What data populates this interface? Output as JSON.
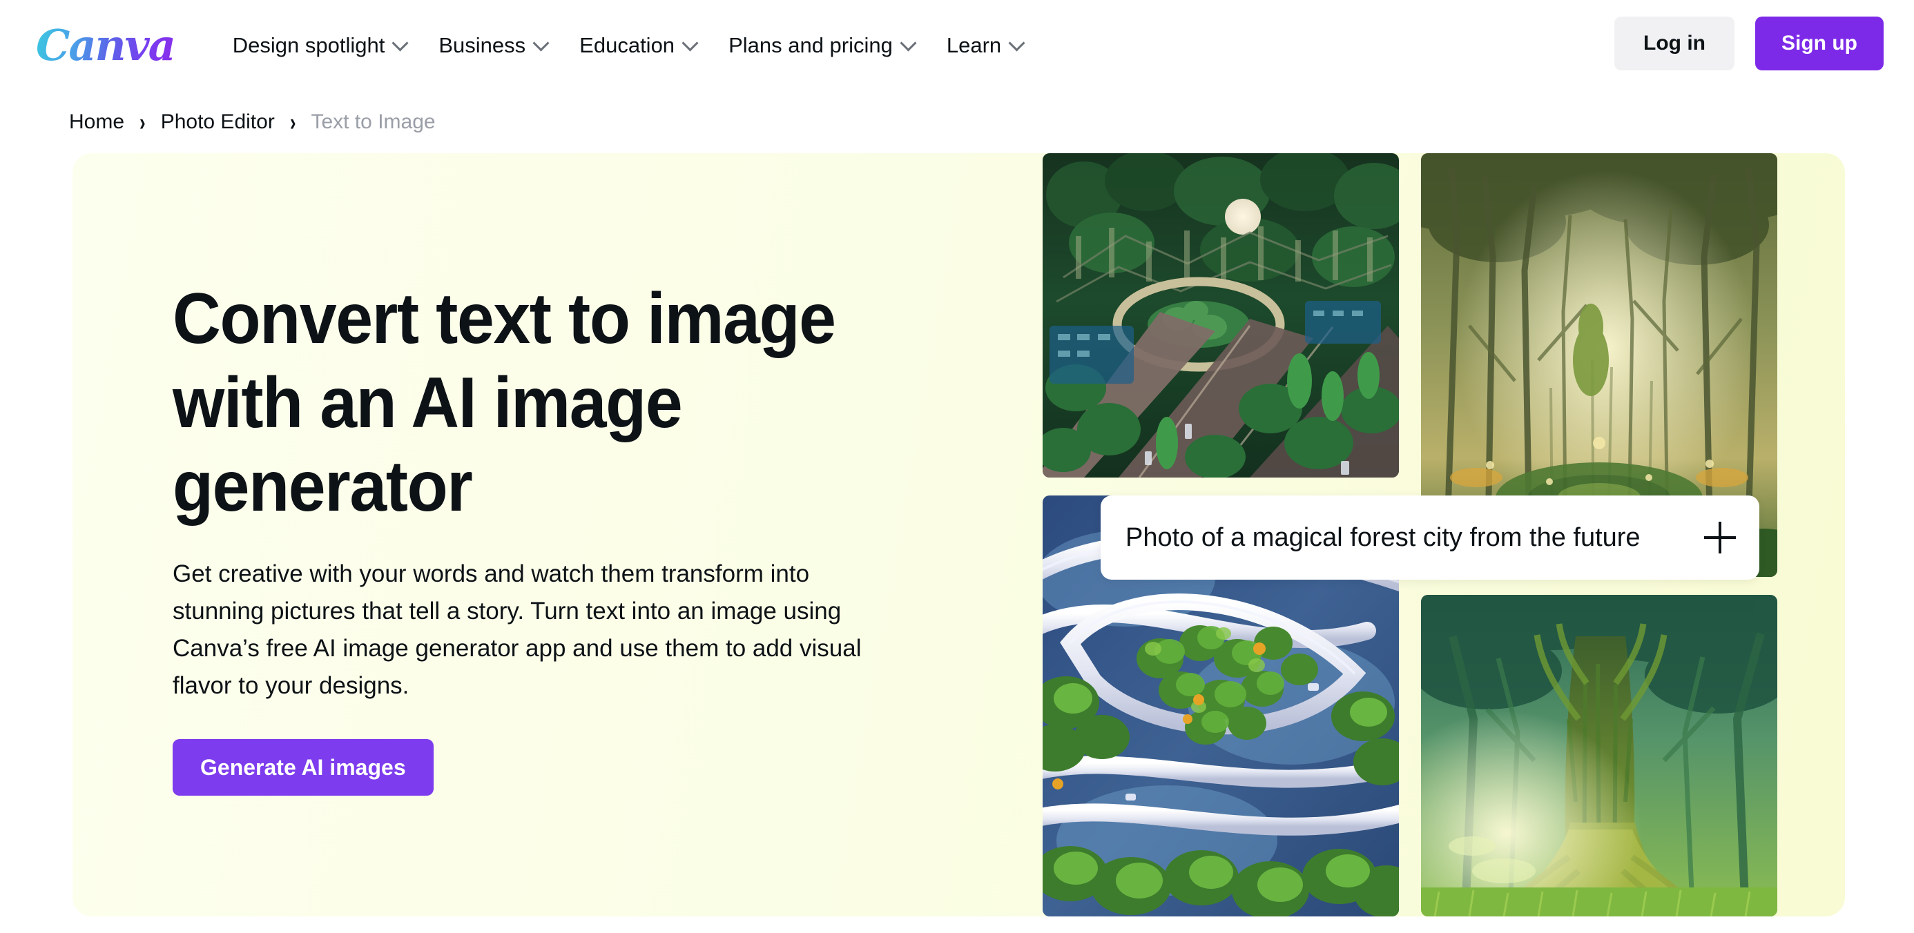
{
  "header": {
    "logo_text": "Canva",
    "nav": [
      {
        "label": "Design spotlight",
        "icon": "chevron-down-icon"
      },
      {
        "label": "Business",
        "icon": "chevron-down-icon"
      },
      {
        "label": "Education",
        "icon": "chevron-down-icon"
      },
      {
        "label": "Plans and pricing",
        "icon": "chevron-down-icon"
      },
      {
        "label": "Learn",
        "icon": "chevron-down-icon"
      }
    ],
    "login_label": "Log in",
    "signup_label": "Sign up"
  },
  "breadcrumb": {
    "separator": "›",
    "items": [
      {
        "label": "Home",
        "current": false
      },
      {
        "label": "Photo Editor",
        "current": false
      },
      {
        "label": "Text to Image",
        "current": true
      }
    ]
  },
  "hero": {
    "title": "Convert text to image with an AI image generator",
    "description": "Get creative with your words and watch them transform into stunning pictures that tell a story. Turn text into an image using Canva’s free AI image generator app and use them to add visual flavor to your designs.",
    "cta_label": "Generate AI images",
    "background_color": "#fbfee6"
  },
  "prompt": {
    "value": "Photo of a magical forest city from the future",
    "add_icon": "plus-icon"
  },
  "gallery": [
    {
      "id": "tile-a",
      "alt": "Aerial view of a futuristic green city with elevated walkways"
    },
    {
      "id": "tile-b",
      "alt": "Misty sunlit forest with tall trees and a glowing clearing"
    },
    {
      "id": "tile-c",
      "alt": "Aerial view of white curving roads winding through treetops and water"
    },
    {
      "id": "tile-d",
      "alt": "Giant mossy tree with sunbeams in a green forest"
    }
  ],
  "colors": {
    "brand_purple": "#7d2ae8",
    "cta_purple": "#7d3ced",
    "hero_yellow": "#fbfee6",
    "login_gray": "#f1f1f3",
    "text_dark": "#0d1216",
    "text_muted": "#9a9ea6"
  }
}
